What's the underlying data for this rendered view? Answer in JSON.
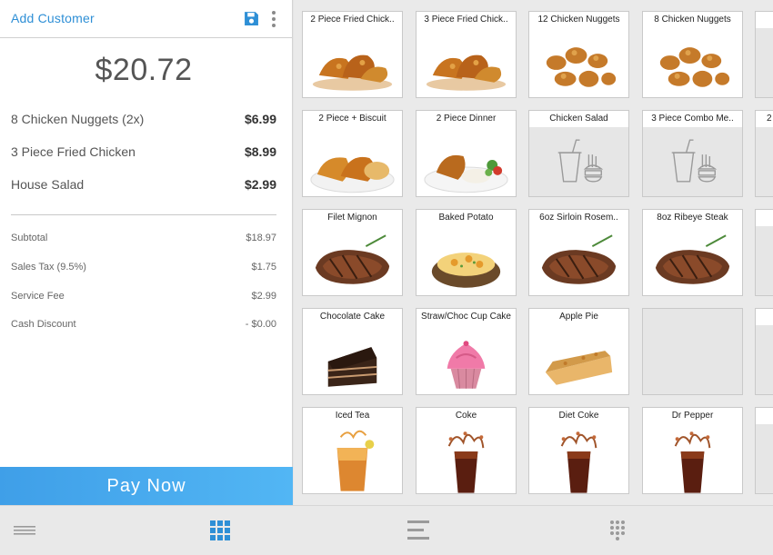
{
  "header": {
    "add_customer_label": "Add Customer",
    "save_icon": "save-icon",
    "more_icon": "more-vertical-icon"
  },
  "order": {
    "total": "$20.72",
    "items": [
      {
        "name": "8 Chicken Nuggets (2x)",
        "price": "$6.99"
      },
      {
        "name": "3 Piece Fried Chicken",
        "price": "$8.99"
      },
      {
        "name": "House Salad",
        "price": "$2.99"
      }
    ],
    "summary": [
      {
        "label": "Subtotal",
        "value": "$18.97"
      },
      {
        "label": "Sales Tax (9.5%)",
        "value": "$1.75"
      },
      {
        "label": "Service Fee",
        "value": "$2.99"
      },
      {
        "label": "Cash Discount",
        "value": "- $0.00"
      }
    ],
    "pay_now_label": "Pay Now"
  },
  "menu": {
    "rows": [
      [
        {
          "label": "2 Piece Fried Chick..",
          "icon": "fried-chicken-image"
        },
        {
          "label": "3 Piece Fried Chick..",
          "icon": "fried-chicken-image"
        },
        {
          "label": "12 Chicken Nuggets",
          "icon": "nuggets-image"
        },
        {
          "label": "8 Chicken Nuggets",
          "icon": "nuggets-image"
        }
      ],
      [
        {
          "label": "2 Piece + Biscuit",
          "icon": "chicken-biscuit-image"
        },
        {
          "label": "2 Piece Dinner",
          "icon": "chicken-dinner-image"
        },
        {
          "label": "Chicken Salad",
          "icon": "combo-placeholder-icon"
        },
        {
          "label": "3 Piece Combo Me..",
          "icon": "combo-placeholder-icon"
        }
      ],
      [
        {
          "label": "Filet Mignon",
          "icon": "steak-image"
        },
        {
          "label": "Baked Potato",
          "icon": "baked-potato-image"
        },
        {
          "label": "6oz Sirloin Rosem..",
          "icon": "steak-image"
        },
        {
          "label": "8oz Ribeye Steak",
          "icon": "steak-image"
        }
      ],
      [
        {
          "label": "Chocolate Cake",
          "icon": "chocolate-cake-image"
        },
        {
          "label": "Straw/Choc Cup Cake",
          "icon": "cupcake-image"
        },
        {
          "label": "Apple Pie",
          "icon": "apple-pie-image"
        },
        {
          "label": "",
          "icon": "empty"
        }
      ],
      [
        {
          "label": "Iced Tea",
          "icon": "iced-tea-image"
        },
        {
          "label": "Coke",
          "icon": "cola-image"
        },
        {
          "label": "Diet Coke",
          "icon": "cola-image"
        },
        {
          "label": "Dr Pepper",
          "icon": "cola-image"
        }
      ]
    ],
    "partial_column_labels": [
      "",
      "2",
      "",
      "",
      ""
    ]
  },
  "bottom_nav": {
    "items": [
      {
        "icon": "menu-lines-icon"
      },
      {
        "icon": "grid-icon",
        "active": true
      },
      {
        "icon": "list-icon"
      },
      {
        "icon": "keypad-icon"
      }
    ]
  },
  "colors": {
    "accent": "#2e8fd6",
    "pay_button": "#47a9ee",
    "active_nav": "#2e8fd6",
    "inactive_nav": "#9a9a9a"
  }
}
